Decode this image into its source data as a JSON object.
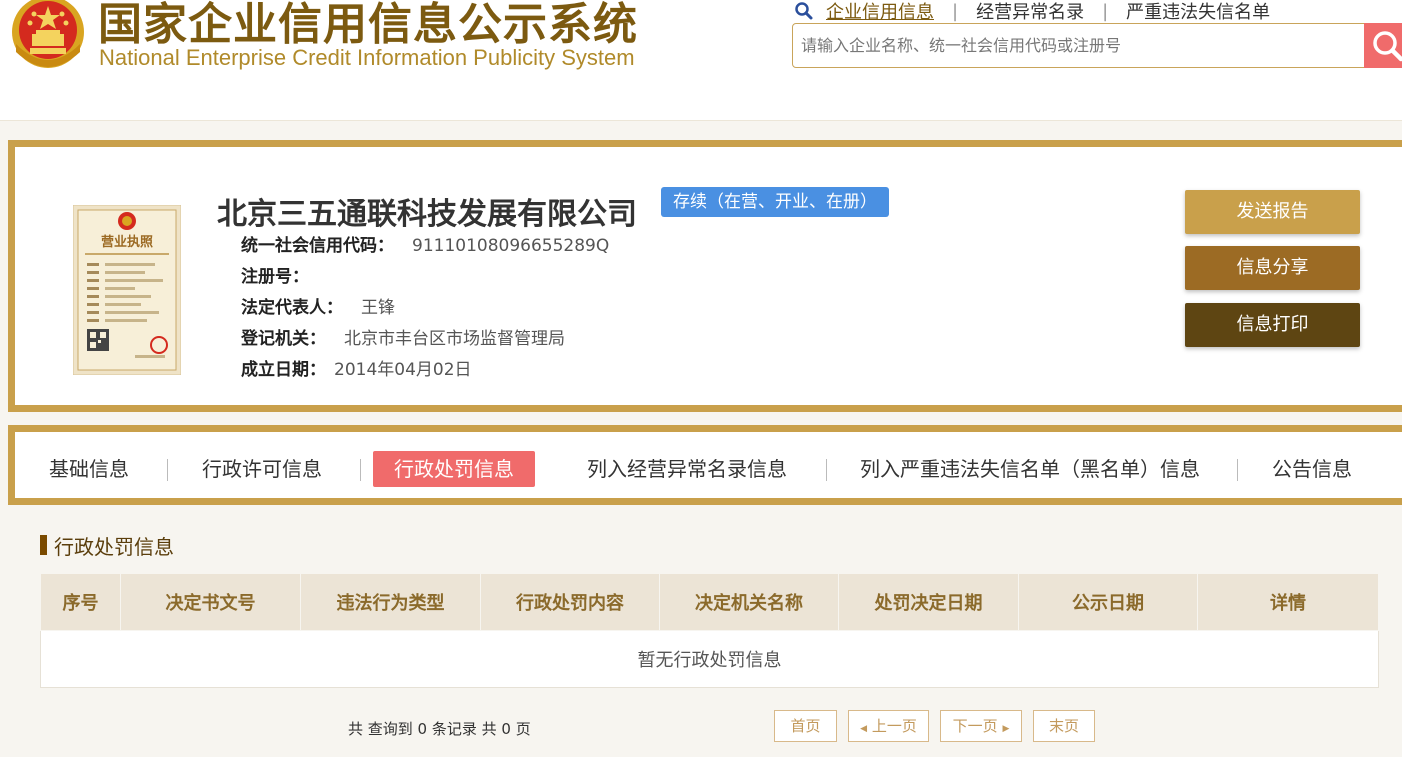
{
  "header": {
    "title_cn": "国家企业信用信息公示系统",
    "title_en": "National Enterprise Credit Information Publicity System",
    "emblem_icon": "national-emblem-icon",
    "nav": [
      {
        "label": "企业信用信息",
        "active": true
      },
      {
        "label": "经营异常名录",
        "active": false
      },
      {
        "label": "严重违法失信名单",
        "active": false
      }
    ],
    "search": {
      "placeholder": "请输入企业名称、统一社会信用代码或注册号",
      "value": "",
      "button_icon": "search-icon"
    }
  },
  "company": {
    "name": "北京三五通联科技发展有限公司",
    "status": "存续（在营、开业、在册）",
    "license_image_title": "营业执照",
    "fields": [
      {
        "label": "统一社会信用代码：",
        "value": "91110108096655289Q"
      },
      {
        "label": "注册号：",
        "value": ""
      },
      {
        "label": "法定代表人：",
        "value": "王锋"
      },
      {
        "label": "登记机关：",
        "value": "北京市丰台区市场监督管理局"
      },
      {
        "label": "成立日期：",
        "value": "2014年04月02日"
      }
    ],
    "actions": {
      "send": "发送报告",
      "share": "信息分享",
      "print": "信息打印"
    }
  },
  "tabs": [
    {
      "label": "基础信息",
      "active": false
    },
    {
      "label": "行政许可信息",
      "active": false
    },
    {
      "label": "行政处罚信息",
      "active": true
    },
    {
      "label": "列入经营异常名录信息",
      "active": false
    },
    {
      "label": "列入严重违法失信名单（黑名单）信息",
      "active": false
    },
    {
      "label": "公告信息",
      "active": false
    }
  ],
  "section": {
    "title": "行政处罚信息",
    "columns": [
      "序号",
      "决定书文号",
      "违法行为类型",
      "行政处罚内容",
      "决定机关名称",
      "处罚决定日期",
      "公示日期",
      "详情"
    ],
    "empty_message": "暂无行政处罚信息"
  },
  "pagination": {
    "summary": "共 查询到 0 条记录 共 0 页",
    "first": "首页",
    "prev": "上一页",
    "next": "下一页",
    "last": "末页"
  },
  "colors": {
    "gold": "#c9a04b",
    "brown": "#9c6b24",
    "dark_brown": "#5e4512",
    "accent_red": "#f06b6b",
    "status_blue": "#4a90e2",
    "title_brown": "#7c5a10"
  }
}
